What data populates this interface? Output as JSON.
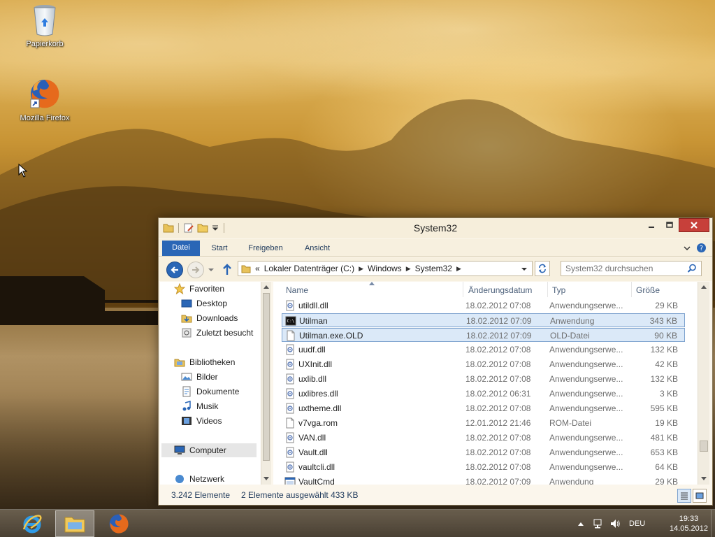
{
  "desktop": {
    "icons": [
      {
        "label": "Papierkorb"
      },
      {
        "label": "Mozilla Firefox"
      }
    ]
  },
  "window": {
    "title": "System32",
    "ribbon_tabs": [
      "Datei",
      "Start",
      "Freigeben",
      "Ansicht"
    ],
    "address": {
      "prefix": "«",
      "crumbs": [
        "Lokaler Datenträger (C:)",
        "Windows",
        "System32"
      ]
    },
    "search_placeholder": "System32 durchsuchen",
    "nav": {
      "favorites": "Favoriten",
      "desktop": "Desktop",
      "downloads": "Downloads",
      "recent": "Zuletzt besucht",
      "libraries": "Bibliotheken",
      "pictures": "Bilder",
      "documents": "Dokumente",
      "music": "Musik",
      "videos": "Videos",
      "computer": "Computer",
      "network": "Netzwerk"
    },
    "columns": {
      "name": "Name",
      "date": "Änderungsdatum",
      "type": "Typ",
      "size": "Größe"
    },
    "files": [
      {
        "name": "utildll.dll",
        "date": "18.02.2012 07:08",
        "type": "Anwendungserwe...",
        "size": "29 KB",
        "icon": "dll-icon",
        "selected": false
      },
      {
        "name": "Utilman",
        "date": "18.02.2012 07:09",
        "type": "Anwendung",
        "size": "343 KB",
        "icon": "console-app-icon",
        "selected": true
      },
      {
        "name": "Utilman.exe.OLD",
        "date": "18.02.2012 07:09",
        "type": "OLD-Datei",
        "size": "90 KB",
        "icon": "blank-file-icon",
        "selected": true
      },
      {
        "name": "uudf.dll",
        "date": "18.02.2012 07:08",
        "type": "Anwendungserwe...",
        "size": "132 KB",
        "icon": "dll-icon",
        "selected": false
      },
      {
        "name": "UXInit.dll",
        "date": "18.02.2012 07:08",
        "type": "Anwendungserwe...",
        "size": "42 KB",
        "icon": "dll-icon",
        "selected": false
      },
      {
        "name": "uxlib.dll",
        "date": "18.02.2012 07:08",
        "type": "Anwendungserwe...",
        "size": "132 KB",
        "icon": "dll-icon",
        "selected": false
      },
      {
        "name": "uxlibres.dll",
        "date": "18.02.2012 06:31",
        "type": "Anwendungserwe...",
        "size": "3 KB",
        "icon": "dll-icon",
        "selected": false
      },
      {
        "name": "uxtheme.dll",
        "date": "18.02.2012 07:08",
        "type": "Anwendungserwe...",
        "size": "595 KB",
        "icon": "dll-icon",
        "selected": false
      },
      {
        "name": "v7vga.rom",
        "date": "12.01.2012 21:46",
        "type": "ROM-Datei",
        "size": "19 KB",
        "icon": "blank-file-icon",
        "selected": false
      },
      {
        "name": "VAN.dll",
        "date": "18.02.2012 07:08",
        "type": "Anwendungserwe...",
        "size": "481 KB",
        "icon": "dll-icon",
        "selected": false
      },
      {
        "name": "Vault.dll",
        "date": "18.02.2012 07:08",
        "type": "Anwendungserwe...",
        "size": "653 KB",
        "icon": "dll-icon",
        "selected": false
      },
      {
        "name": "vaultcli.dll",
        "date": "18.02.2012 07:08",
        "type": "Anwendungserwe...",
        "size": "64 KB",
        "icon": "dll-icon",
        "selected": false
      },
      {
        "name": "VaultCmd",
        "date": "18.02.2012 07:09",
        "type": "Anwendung",
        "size": "29 KB",
        "icon": "window-app-icon",
        "selected": false
      }
    ],
    "status": {
      "count": "3.242 Elemente",
      "selection": "2 Elemente ausgewählt  433 KB"
    }
  },
  "taskbar": {
    "language": "DEU",
    "time": "19:33",
    "date": "14.05.2012"
  },
  "colors": {
    "accent": "#2a66b6",
    "selection": "#dbe9f8",
    "close": "#c7403a"
  }
}
